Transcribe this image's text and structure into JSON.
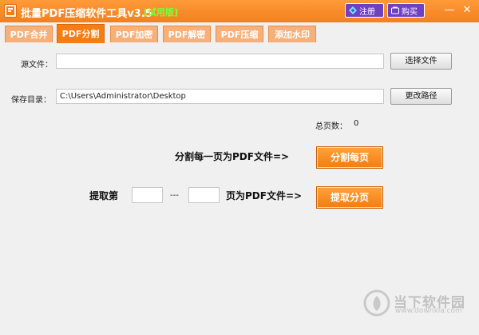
{
  "window": {
    "title": "批量PDF压缩软件工具v3.5",
    "trial_label": "[试用版]",
    "register_label": "注册",
    "buy_label": "购买",
    "minimize_glyph": "—",
    "close_glyph": "✕"
  },
  "tabs": [
    {
      "label": "PDF合并"
    },
    {
      "label": "PDF分割"
    },
    {
      "label": "PDF加密"
    },
    {
      "label": "PDF解密"
    },
    {
      "label": "PDF压缩"
    },
    {
      "label": "添加水印"
    }
  ],
  "active_tab": 1,
  "source": {
    "label": "源文件：",
    "value": "",
    "button": "选择文件"
  },
  "save": {
    "label": "保存目录：",
    "value": "C:\\Users\\Administrator\\Desktop",
    "button": "更改路径"
  },
  "page_count": {
    "label": "总页数：",
    "value": "0"
  },
  "split_each": {
    "label": "分割每一页为PDF文件=>",
    "button": "分割每页"
  },
  "extract": {
    "prefix": "提取第",
    "from_value": "",
    "separator": "---",
    "to_value": "",
    "suffix": "页为PDF文件=>",
    "button": "提取分页"
  },
  "watermark": {
    "text": "当下软件园",
    "url": "www.downxia.com"
  },
  "colors": {
    "accent": "#f57d12",
    "tab_inactive": "#f7b07a",
    "purple_button": "#6f3fc4"
  },
  "icons": {
    "app": "pdf-app-icon",
    "register": "diamond-icon",
    "buy": "cart-icon"
  }
}
